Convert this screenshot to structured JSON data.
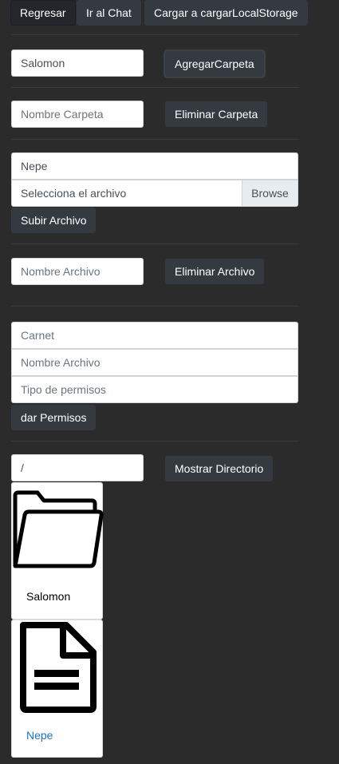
{
  "toolbar": {
    "regresar": "Regresar",
    "chat": "Ir al Chat",
    "cargar": "Cargar a cargarLocalStorage"
  },
  "carpeta_add": {
    "value": "Salomon",
    "button": "AgregarCarpeta"
  },
  "carpeta_delete": {
    "placeholder": "Nombre Carpeta",
    "button": "Eliminar Carpeta"
  },
  "upload": {
    "name_value": "Nepe",
    "file_label": "Selecciona el archivo",
    "browse": "Browse",
    "button": "Subir Archivo"
  },
  "archivo_delete": {
    "placeholder": "Nombre Archivo",
    "button": "Eliminar Archivo"
  },
  "permisos": {
    "carnet_placeholder": "Carnet",
    "archivo_placeholder": "Nombre Archivo",
    "tipo_placeholder": "Tipo de permisos",
    "button": "dar Permisos"
  },
  "directorio": {
    "value": "/",
    "button": "Mostrar Directorio"
  },
  "items": [
    {
      "icon": "folder-icon",
      "name": "Salomon",
      "color": "#000000"
    },
    {
      "icon": "document-icon",
      "name": "Nepe",
      "color": "#1a73c8"
    }
  ]
}
